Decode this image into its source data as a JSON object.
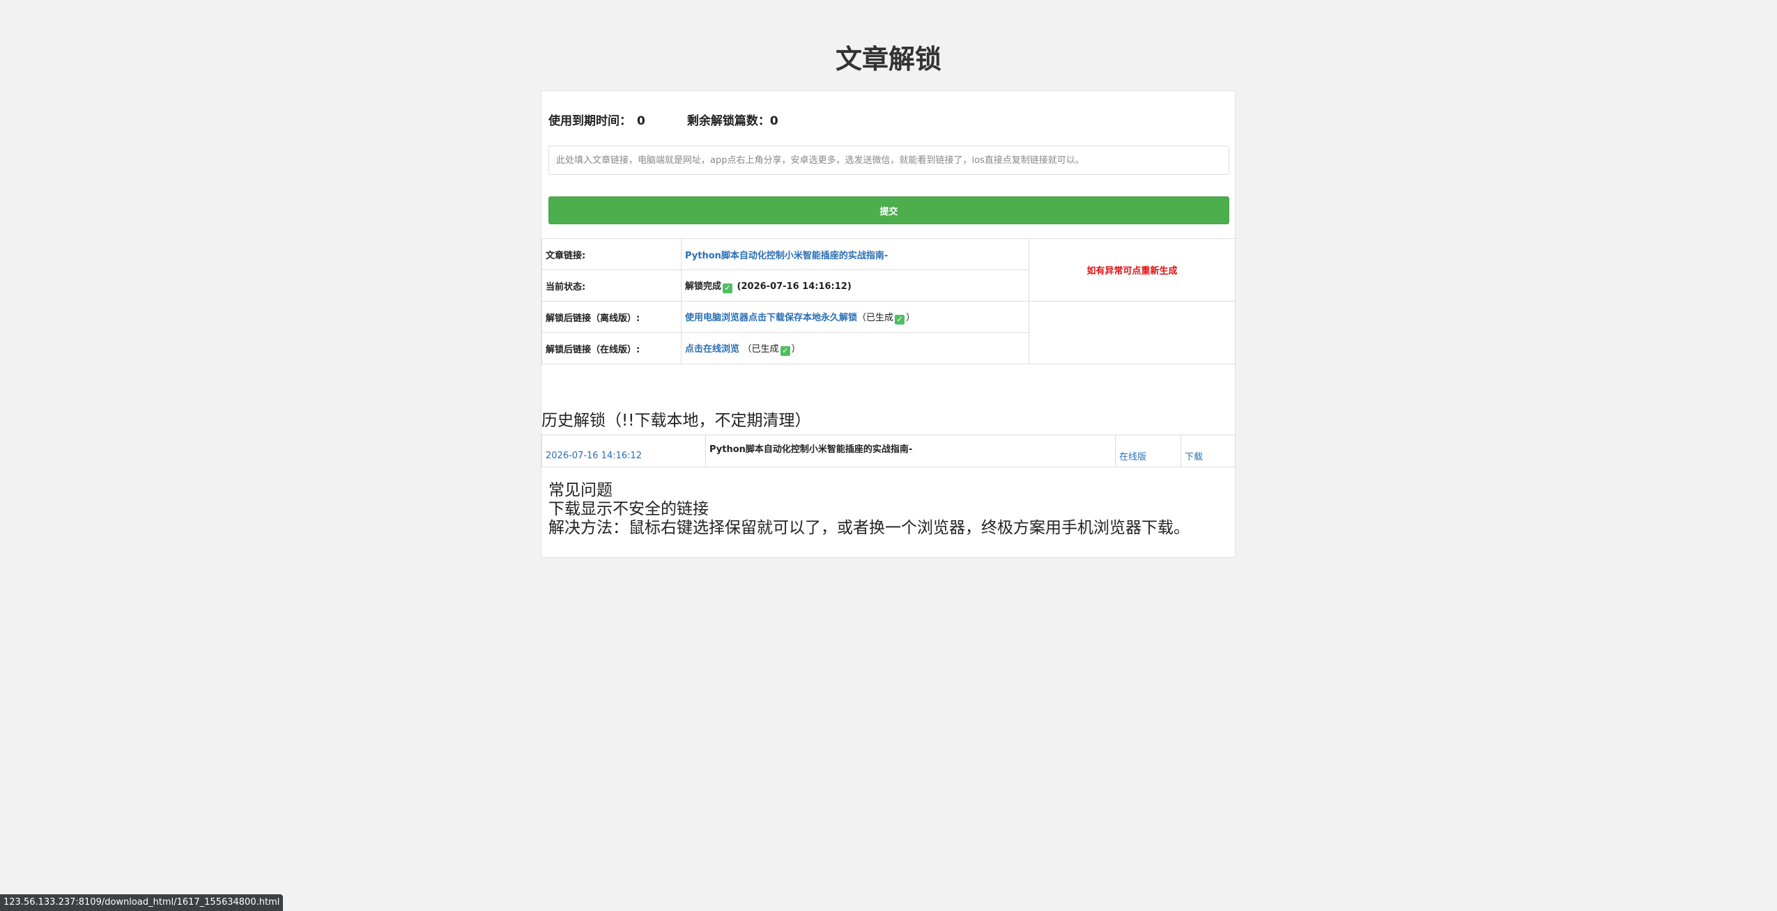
{
  "page": {
    "title": "文章解锁"
  },
  "stats": {
    "expire_label": "使用到期时间：",
    "expire_value": "0",
    "remaining_label": "剩余解锁篇数：",
    "remaining_value": "0"
  },
  "form": {
    "input_placeholder": "此处填入文章链接，电脑端就是网址，app点右上角分享，安卓选更多，选发送微信，就能看到链接了，ios直接点复制链接就可以。",
    "input_value": "",
    "submit_label": "提交"
  },
  "result": {
    "article_link_label": "文章链接:",
    "article_link_text": "Python脚本自动化控制小米智能插座的实战指南-",
    "status_label": "当前状态:",
    "status_text": "解锁完成",
    "status_time": "(2026-07-16 14:16:12)",
    "regen_text": "如有异常可点重新生成",
    "offline_label": "解锁后链接（离线版）:",
    "offline_link_text": "使用电脑浏览器点击下载保存本地永久解锁",
    "offline_suffix_open": "（已生成",
    "offline_suffix_close": "）",
    "online_label": "解锁后链接（在线版）:",
    "online_link_text": "点击在线浏览",
    "online_suffix_open": "（已生成",
    "online_suffix_close": "）",
    "check_glyph": "✓"
  },
  "history": {
    "title": "历史解锁（!!下载本地，不定期清理）",
    "rows": [
      {
        "time": "2026-07-16 14:16:12",
        "article": "Python脚本自动化控制小米智能插座的实战指南-",
        "online_label": "在线版",
        "download_label": "下载"
      }
    ]
  },
  "faq": {
    "heading": "常见问题",
    "question": "下载显示不安全的链接",
    "answer": "解决方法：鼠标右键选择保留就可以了，或者换一个浏览器，终极方案用手机浏览器下载。"
  },
  "browser": {
    "status_url": "123.56.133.237:8109/download_html/1617_155634800.html"
  },
  "colors": {
    "accent_green": "#4cae4c",
    "link_blue": "#2a6fb5",
    "warning_red": "#e01010",
    "check_green": "#4fbf63"
  }
}
